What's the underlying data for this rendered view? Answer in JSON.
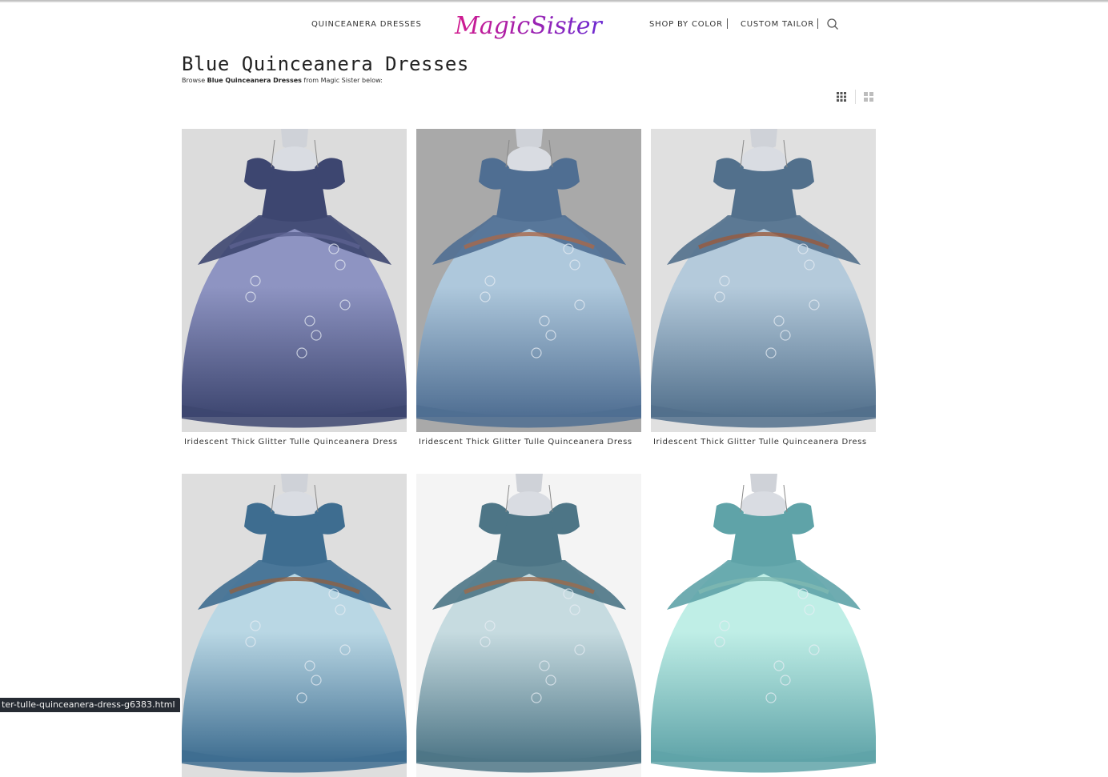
{
  "nav": {
    "left_link": "QUINCEANERA DRESSES",
    "logo_text": "MagicSister",
    "shop_by_color": "SHOP BY COLOR",
    "custom_tailor": "CUSTOM TAILOR",
    "search_icon": "search-icon"
  },
  "page": {
    "title": "Blue Quinceanera Dresses",
    "subtitle_prefix": "Browse ",
    "subtitle_bold": "Blue Quinceanera Dresses",
    "subtitle_suffix": " from Magic Sister below:"
  },
  "view_toggles": [
    "grid-3-icon",
    "grid-2-icon"
  ],
  "products": [
    {
      "name": "Iridescent Thick Glitter Tulle Quinceanera Dress",
      "bg": "#dcdcdc",
      "dress": "#3d4670",
      "skirt": "#8e94c2",
      "trim": "#5b6290"
    },
    {
      "name": "Iridescent Thick Glitter Tulle Quinceanera Dress",
      "bg": "#a9a9a9",
      "dress": "#4f6e92",
      "skirt": "#aec8dc",
      "trim": "#a7684a"
    },
    {
      "name": "Iridescent Thick Glitter Tulle Quinceanera Dress",
      "bg": "#e0e0e0",
      "dress": "#52708c",
      "skirt": "#b4cadb",
      "trim": "#9a5a3c"
    },
    {
      "name": "",
      "bg": "#dedede",
      "dress": "#3e6d90",
      "skirt": "#b9d7e4",
      "trim": "#8c6043"
    },
    {
      "name": "",
      "bg": "#f4f4f4",
      "dress": "#4d7586",
      "skirt": "#c6dbe0",
      "trim": "#9b6a4b"
    },
    {
      "name": "",
      "bg": "#ffffff",
      "dress": "#5fa3a8",
      "skirt": "#bfeee6",
      "trim": "#7fb9b2"
    }
  ],
  "status_bar": "ter-tulle-quinceanera-dress-g6383.html"
}
